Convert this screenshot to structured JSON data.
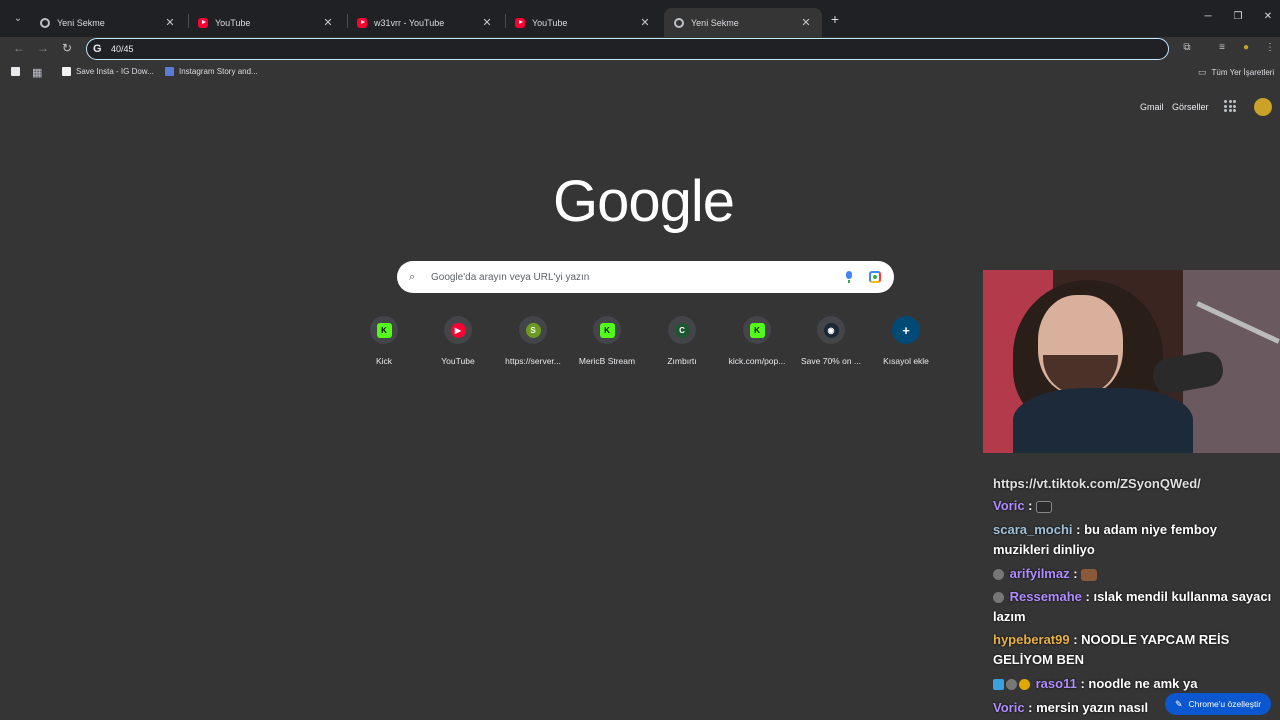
{
  "tabs": [
    {
      "title": "Yeni Sekme",
      "icon": "chrome-icon"
    },
    {
      "title": "YouTube",
      "icon": "youtube-icon"
    },
    {
      "title": "w31vrr - YouTube",
      "icon": "youtube-icon"
    },
    {
      "title": "YouTube",
      "icon": "youtube-icon"
    },
    {
      "title": "Yeni Sekme",
      "icon": "chrome-icon",
      "active": true
    }
  ],
  "omnibox": {
    "value": "40/45"
  },
  "bookmarks": {
    "items": [
      {
        "label": "Save Insta - IG Dow..."
      },
      {
        "label": "Instagram Story and..."
      }
    ],
    "all_label": "Tüm Yer İşaretleri"
  },
  "header_links": {
    "gmail": "Gmail",
    "images": "Görseller"
  },
  "logo": "Google",
  "search": {
    "placeholder": "Google'da arayın veya URL'yi yazın"
  },
  "shortcuts": [
    {
      "label": "Kick",
      "letter": "K",
      "color": "#53fc18"
    },
    {
      "label": "YouTube",
      "letter": "",
      "color": "#ff0033"
    },
    {
      "label": "https://server...",
      "letter": "S",
      "color": "#6a9a1f"
    },
    {
      "label": "MericB Stream",
      "letter": "K",
      "color": "#53fc18"
    },
    {
      "label": "Zımbırtı",
      "letter": "C",
      "color": "#1e5631"
    },
    {
      "label": "kick.com/pop...",
      "letter": "K",
      "color": "#53fc18"
    },
    {
      "label": "Save 70% on ...",
      "letter": "S",
      "color": "#1b2838"
    },
    {
      "label": "Kısayol ekle",
      "letter": "+",
      "color": "#004a77"
    }
  ],
  "chat": {
    "partial": "https://vt.tiktok.com/ZSyonQWed/",
    "messages": [
      {
        "user": "Voric",
        "color": "#b18cff",
        "text": ""
      },
      {
        "user": "scara_mochi",
        "color": "#9ec1d9",
        "text": "bu adam niye femboy muzikleri dinliyo"
      },
      {
        "user": "arifyilmaz",
        "color": "#b18cff",
        "text": ""
      },
      {
        "user": "Ressemahe",
        "color": "#b18cff",
        "text": "ıslak mendil kullanma sayacı lazım"
      },
      {
        "user": "hypeberat99",
        "color": "#e8b04a",
        "text": "NOODLE YAPCAM REİS GELİYOM BEN"
      },
      {
        "user": "raso11",
        "color": "#b18cff",
        "text": "noodle ne amk ya"
      },
      {
        "user": "Voric",
        "color": "#b18cff",
        "text": "mersin yazın nasıl"
      }
    ]
  },
  "customize": {
    "label": "Chrome'u özelleştir"
  }
}
